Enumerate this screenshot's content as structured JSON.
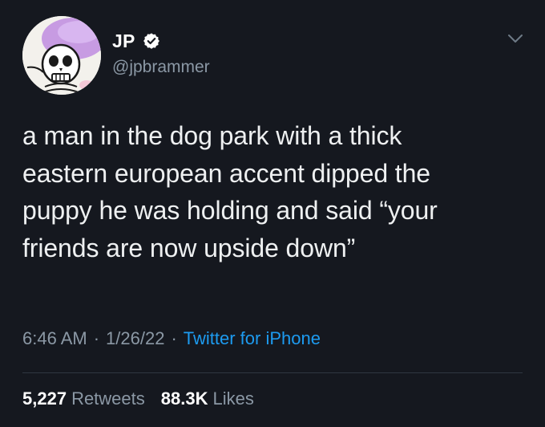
{
  "author": {
    "display_name": "JP",
    "handle": "@jpbrammer",
    "verified": true,
    "avatar": "skeleton-avatar-icon"
  },
  "tweet": {
    "text": "a man in the dog park with a thick\neastern european accent dipped the\npuppy he was holding and said “your\nfriends are now upside down”"
  },
  "meta": {
    "time": "6:46 AM",
    "separator": "·",
    "date": "1/26/22",
    "source": "Twitter for iPhone"
  },
  "stats": {
    "retweets_count": "5,227",
    "retweets_label": "Retweets",
    "likes_count": "88.3K",
    "likes_label": "Likes"
  },
  "colors": {
    "background": "#15181f",
    "text": "#e7e9ea",
    "muted": "#8b98a5",
    "link": "#1d9bf0",
    "verified_badge": "#ffffff"
  },
  "icons": {
    "verified": "verified-badge-icon",
    "menu": "chevron-down-icon"
  }
}
